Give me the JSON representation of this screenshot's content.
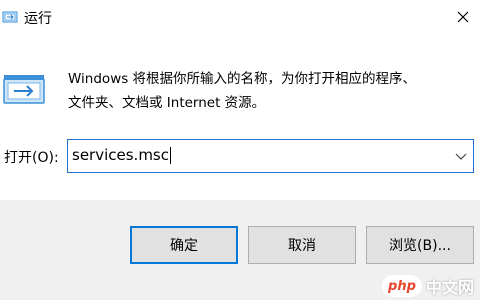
{
  "window": {
    "title": "运行",
    "app_icon": "run-icon",
    "close_icon": "close-icon"
  },
  "description": {
    "line1": "Windows 将根据你所输入的名称，为你打开相应的程序、",
    "line2": "文件夹、文档或 Internet 资源。",
    "icon": "run-large-icon"
  },
  "open_field": {
    "label": "打开(O):",
    "value": "services.msc",
    "dropdown_icon": "chevron-down-icon"
  },
  "buttons": {
    "ok": "确定",
    "cancel": "取消",
    "browse": "浏览(B)..."
  },
  "watermark": {
    "badge": "php",
    "text": "中文网"
  },
  "colors": {
    "accent": "#0078d7",
    "input_border": "#1e70d2",
    "footer_bg": "#f0f0f0"
  }
}
